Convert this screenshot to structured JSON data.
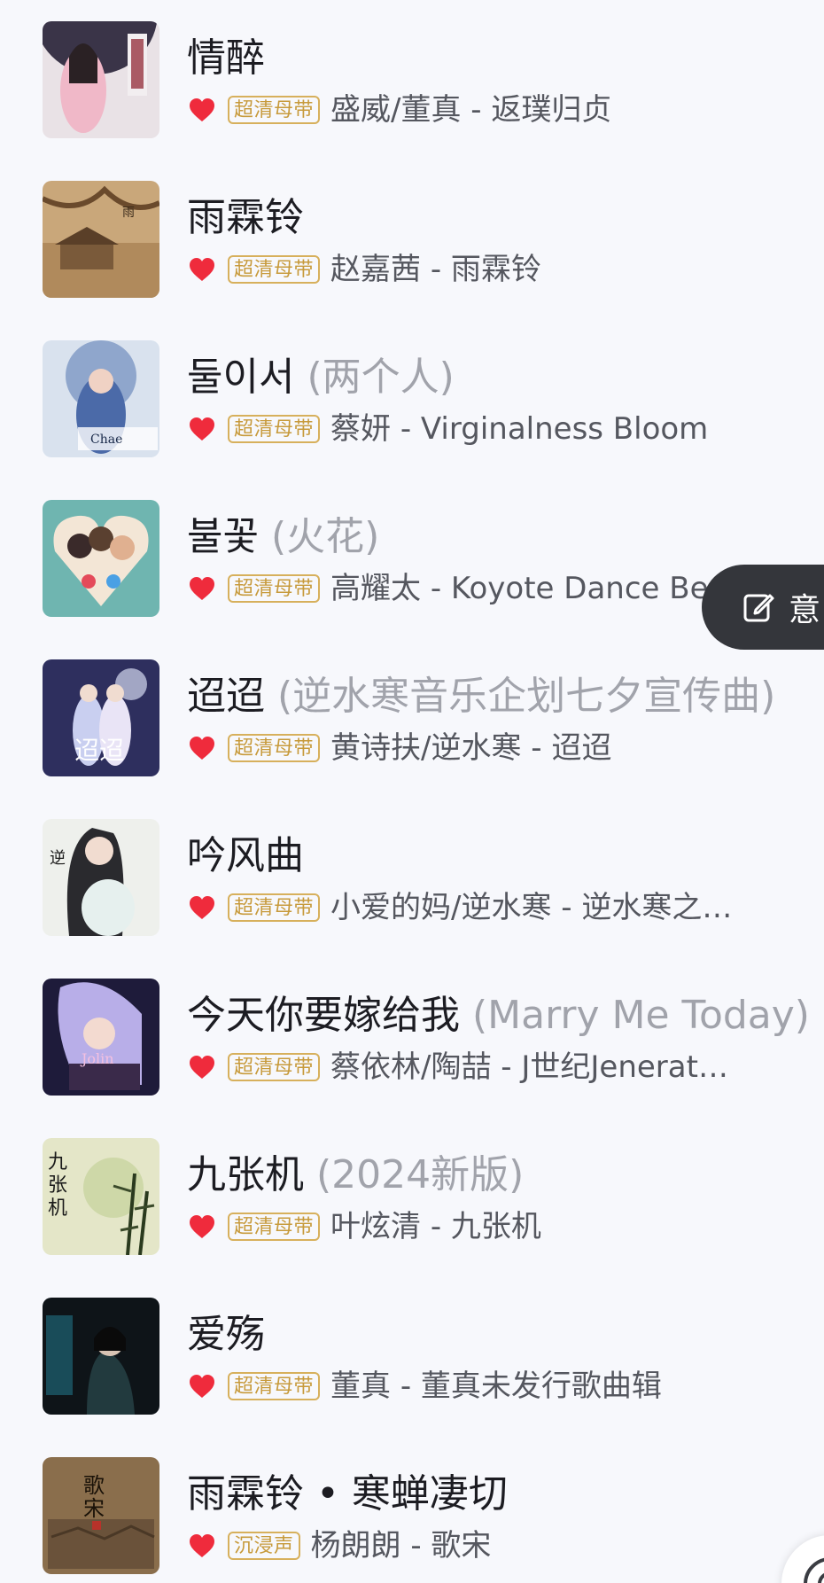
{
  "colors": {
    "background": "#f7f8fc",
    "heart": "#ef2b3c",
    "badge_gold": "#c79a3b",
    "title": "#1c1c22",
    "subtitle": "#a1a3ab",
    "meta": "#55575f",
    "pill_bg": "#34363b"
  },
  "songs": [
    {
      "title": "情醉",
      "subtitle": "",
      "badge": "超清母带",
      "meta": "盛威/董真 - 返璞归贞",
      "liked": true,
      "cover_icon": "album-cover-woman-umbrella"
    },
    {
      "title": "雨霖铃",
      "subtitle": "",
      "badge": "超清母带",
      "meta": "赵嘉茜 - 雨霖铃",
      "liked": true,
      "cover_icon": "album-cover-pavilion"
    },
    {
      "title": "둘이서",
      "subtitle": "(两个人)",
      "badge": "超清母带",
      "meta": "蔡妍 - Virginalness Bloom",
      "liked": true,
      "cover_icon": "album-cover-chae-yeon"
    },
    {
      "title": "불꽃",
      "subtitle": "(火花)",
      "badge": "超清母带",
      "meta": "高耀太 - Koyote Dance Best",
      "liked": true,
      "cover_icon": "album-cover-koyote"
    },
    {
      "title": "迢迢",
      "subtitle": "(逆水寒音乐企划七夕宣传曲)",
      "badge": "超清母带",
      "meta": "黄诗扶/逆水寒 - 迢迢",
      "liked": true,
      "cover_icon": "album-cover-couple-night"
    },
    {
      "title": "吟风曲",
      "subtitle": "",
      "badge": "超清母带",
      "meta": "小爱的妈/逆水寒 - 逆水寒之…",
      "liked": true,
      "cover_icon": "album-cover-swordswoman"
    },
    {
      "title": "今天你要嫁给我",
      "subtitle": "(Marry Me Today)",
      "badge": "超清母带",
      "meta": "蔡依林/陶喆 - J世纪Jenerat…",
      "liked": true,
      "cover_icon": "album-cover-jolin"
    },
    {
      "title": "九张机",
      "subtitle": "(2024新版)",
      "badge": "超清母带",
      "meta": "叶炫清 - 九张机",
      "liked": true,
      "cover_icon": "album-cover-bamboo"
    },
    {
      "title": "爱殇",
      "subtitle": "",
      "badge": "超清母带",
      "meta": "董真 - 董真未发行歌曲辑",
      "liked": true,
      "cover_icon": "album-cover-dark-portrait"
    },
    {
      "title": "雨霖铃 • 寒蝉凄切",
      "subtitle": "",
      "badge": "沉浸声",
      "meta": "杨朗朗 - 歌宋",
      "liked": true,
      "cover_icon": "album-cover-song-dynasty"
    }
  ],
  "float_button": {
    "label": "意",
    "icon": "edit-icon"
  },
  "corner_button": {
    "icon": "record-icon"
  }
}
